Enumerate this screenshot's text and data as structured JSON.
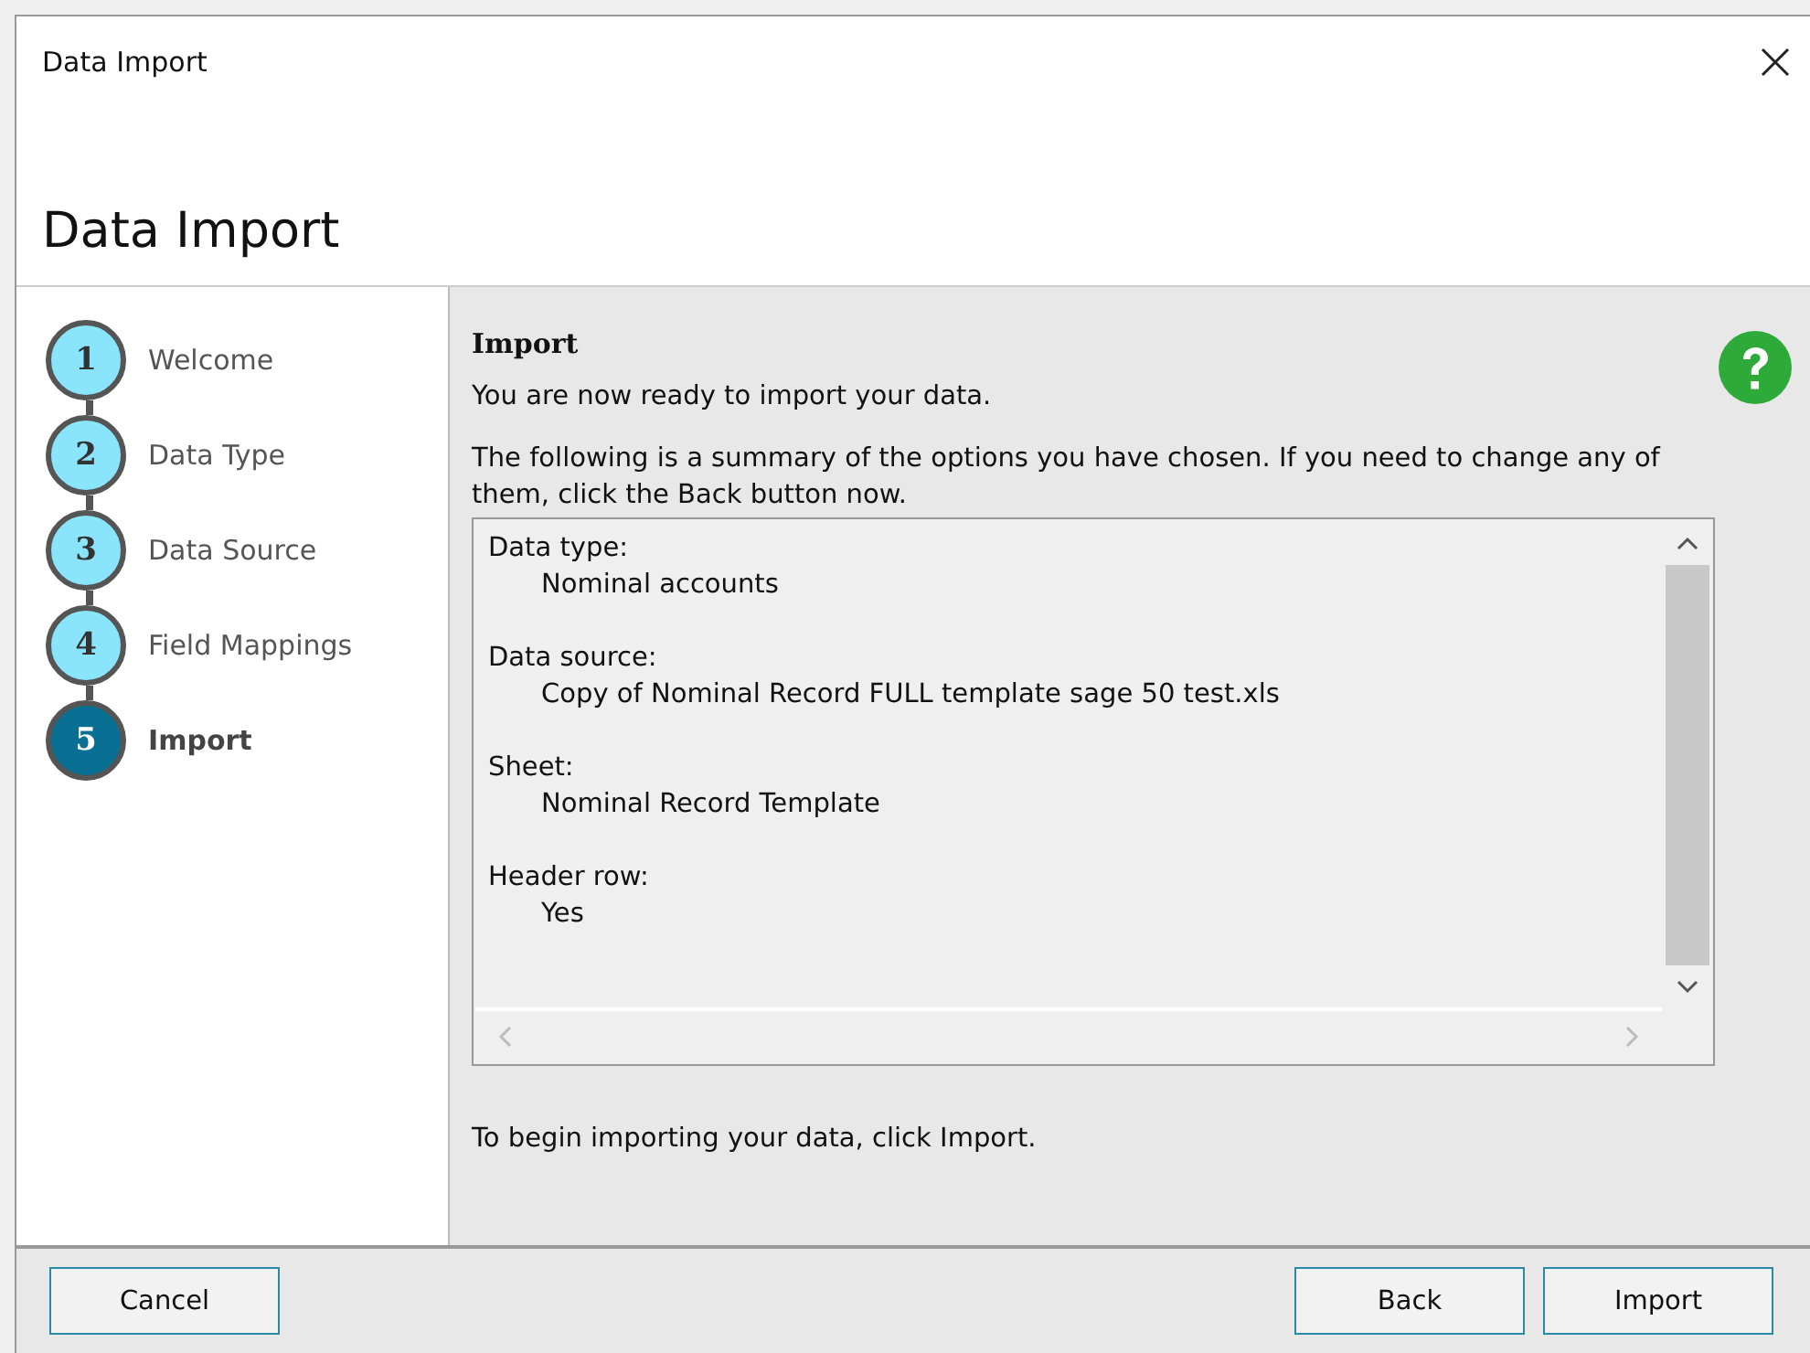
{
  "window": {
    "title": "Data Import"
  },
  "header": {
    "title": "Data Import"
  },
  "steps": [
    {
      "number": "1",
      "label": "Welcome",
      "selected": false
    },
    {
      "number": "2",
      "label": "Data Type",
      "selected": false
    },
    {
      "number": "3",
      "label": "Data Source",
      "selected": false
    },
    {
      "number": "4",
      "label": "Field Mappings",
      "selected": false
    },
    {
      "number": "5",
      "label": "Import",
      "selected": true
    }
  ],
  "content": {
    "heading": "Import",
    "intro": "You are now ready to import your data.",
    "summary_note": "The following is a summary of the options you have chosen. If you need to change any of them, click the Back button now.",
    "summary": [
      {
        "label": "Data type:",
        "value": "Nominal accounts"
      },
      {
        "label": "Data source:",
        "value": "Copy of Nominal Record FULL template sage 50 test.xls"
      },
      {
        "label": "Sheet:",
        "value": "Nominal Record Template"
      },
      {
        "label": "Header row:",
        "value": "Yes"
      }
    ],
    "footer_note": "To begin importing your data, click Import."
  },
  "buttons": {
    "left": [
      "Cancel"
    ],
    "right": [
      "Back",
      "Import"
    ]
  }
}
